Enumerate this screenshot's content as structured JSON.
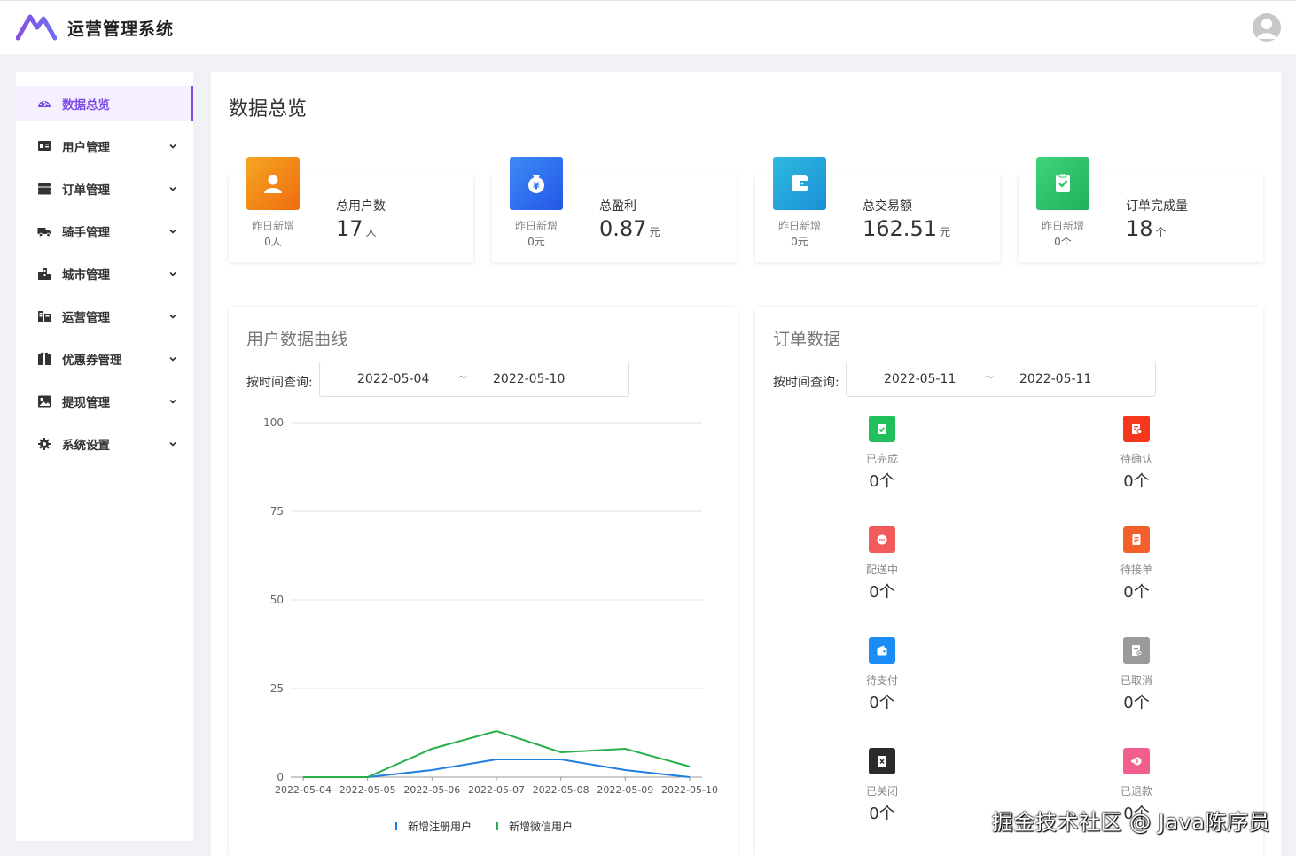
{
  "app": {
    "title": "运营管理系统"
  },
  "sidebar": {
    "items": [
      {
        "label": "数据总览",
        "icon": "dashboard-icon",
        "active": true
      },
      {
        "label": "用户管理",
        "icon": "user-card-icon"
      },
      {
        "label": "订单管理",
        "icon": "order-list-icon"
      },
      {
        "label": "骑手管理",
        "icon": "truck-icon"
      },
      {
        "label": "城市管理",
        "icon": "building-icon"
      },
      {
        "label": "运营管理",
        "icon": "operations-icon"
      },
      {
        "label": "优惠券管理",
        "icon": "coupon-icon"
      },
      {
        "label": "提现管理",
        "icon": "withdraw-icon"
      },
      {
        "label": "系统设置",
        "icon": "gear-icon"
      }
    ]
  },
  "page": {
    "title": "数据总览"
  },
  "stats": [
    {
      "name": "总用户数",
      "value": "17",
      "unit": "人",
      "sub_label": "昨日新增",
      "sub_value": "0人",
      "color": "#f08a12",
      "icon": "user-icon"
    },
    {
      "name": "总盈利",
      "value": "0.87",
      "unit": "元",
      "sub_label": "昨日新增",
      "sub_value": "0元",
      "color": "#2f6ff0",
      "icon": "money-bag-icon"
    },
    {
      "name": "总交易额",
      "value": "162.51",
      "unit": "元",
      "sub_label": "昨日新增",
      "sub_value": "0元",
      "color": "#1fa6d9",
      "icon": "wallet-icon"
    },
    {
      "name": "订单完成量",
      "value": "18",
      "unit": "个",
      "sub_label": "昨日新增",
      "sub_value": "0个",
      "color": "#2cc36b",
      "icon": "clipboard-check-icon"
    }
  ],
  "user_panel": {
    "title": "用户数据曲线",
    "query_label": "按时间查询:",
    "date_start": "2022-05-04",
    "date_sep": "~",
    "date_end": "2022-05-10"
  },
  "order_panel": {
    "title": "订单数据",
    "query_label": "按时间查询:",
    "date_start": "2022-05-11",
    "date_sep": "~",
    "date_end": "2022-05-11",
    "items": [
      {
        "label": "已完成",
        "count": "0个",
        "color": "#22c05c",
        "icon": "clipboard-check-icon"
      },
      {
        "label": "待确认",
        "count": "0个",
        "color": "#f5371e",
        "icon": "doc-pending-icon"
      },
      {
        "label": "配送中",
        "count": "0个",
        "color": "#f25b5b",
        "icon": "chat-bubble-icon"
      },
      {
        "label": "待接单",
        "count": "0个",
        "color": "#f4602c",
        "icon": "doc-accept-icon"
      },
      {
        "label": "待支付",
        "count": "0个",
        "color": "#1a8cf5",
        "icon": "wallet-icon"
      },
      {
        "label": "已取消",
        "count": "0个",
        "color": "#9a9a9a",
        "icon": "doc-cancel-icon"
      },
      {
        "label": "已关闭",
        "count": "0个",
        "color": "#2b2b2b",
        "icon": "doc-close-icon"
      },
      {
        "label": "已退款",
        "count": "0个",
        "color": "#f25f8c",
        "icon": "refund-icon"
      }
    ]
  },
  "chart_data": {
    "type": "line",
    "x": [
      "2022-05-04",
      "2022-05-05",
      "2022-05-06",
      "2022-05-07",
      "2022-05-08",
      "2022-05-09",
      "2022-05-10"
    ],
    "ylim": [
      0,
      100
    ],
    "yticks": [
      0,
      25,
      50,
      75,
      100
    ],
    "grid": true,
    "legend": "bottom",
    "series": [
      {
        "name": "新增注册用户",
        "color": "#1f7fe0",
        "values": [
          0,
          0,
          2,
          5,
          5,
          2,
          0
        ]
      },
      {
        "name": "新增微信用户",
        "color": "#27b04a",
        "values": [
          0,
          0,
          8,
          13,
          7,
          8,
          3
        ]
      }
    ]
  },
  "watermark": "掘金技术社区 @ Java陈序员"
}
